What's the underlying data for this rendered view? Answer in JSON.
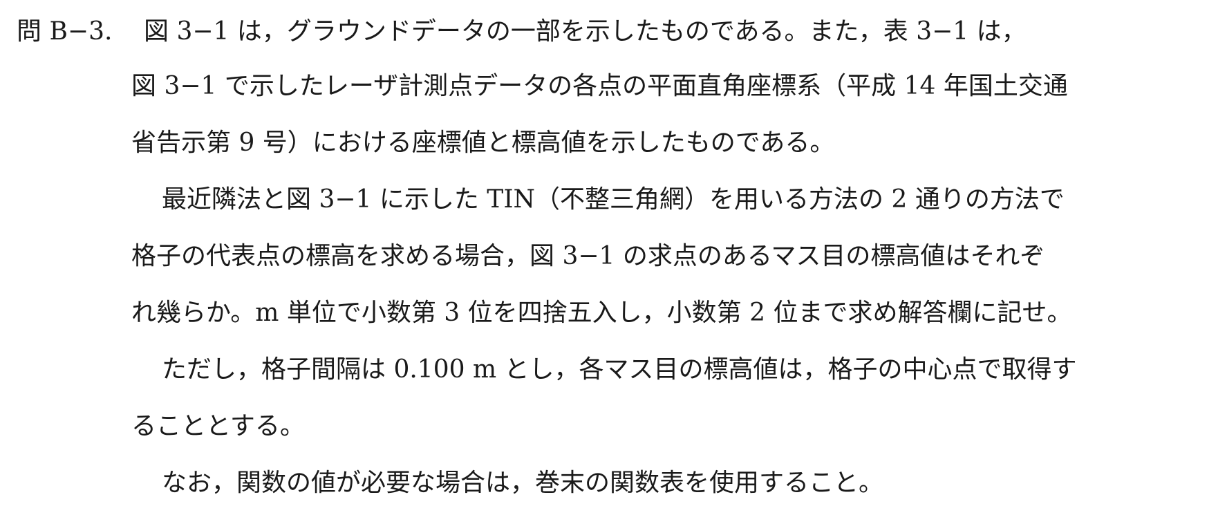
{
  "question": {
    "number": "問 B−3.",
    "first_line": "図 3−1 は，グラウンドデータの一部を示したものである。また，表 3−1 は，"
  },
  "lines": [
    "図 3−1 で示したレーザ計測点データの各点の平面直角座標系（平成 14 年国土交通",
    "省告示第 9 号）における座標値と標高値を示したものである。",
    "最近隣法と図 3−1 に示した TIN（不整三角網）を用いる方法の 2 通りの方法で",
    "格子の代表点の標高を求める場合，図 3−1 の求点のあるマス目の標高値はそれぞ",
    "れ幾らか。m 単位で小数第 3 位を四捨五入し，小数第 2 位まで求め解答欄に記せ。",
    "ただし，格子間隔は 0.100 m とし，各マス目の標高値は，格子の中心点で取得す",
    "ることとする。",
    "なお，関数の値が必要な場合は，巻末の関数表を使用すること。"
  ]
}
